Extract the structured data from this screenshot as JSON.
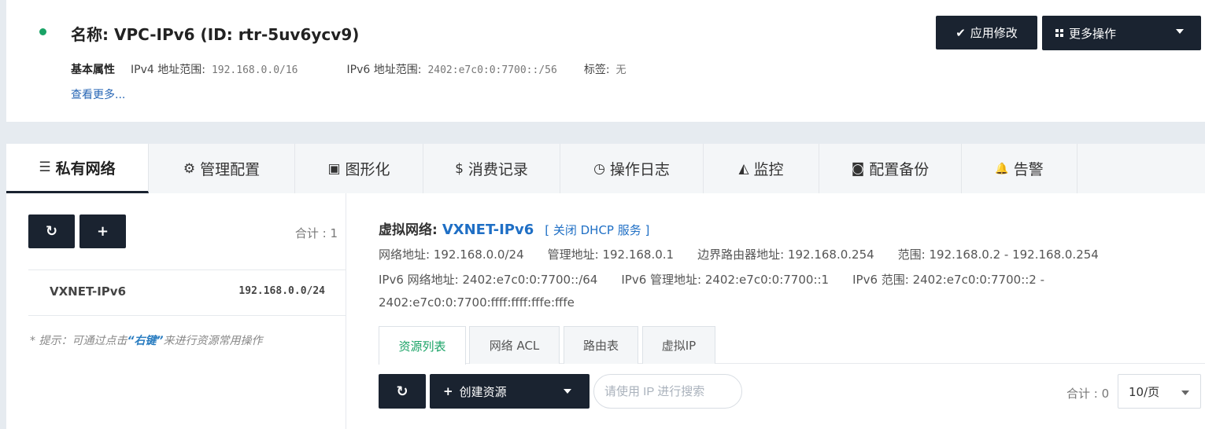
{
  "header": {
    "title": "名称: VPC-IPv6 (ID: rtr-5uv6ycv9)",
    "status_color": "#1aa366",
    "basic_props_label": "基本属性",
    "ipv4_label": "IPv4 地址范围:",
    "ipv4_value": "192.168.0.0/16",
    "ipv6_label": "IPv6 地址范围:",
    "ipv6_value": "2402:e7c0:0:7700::/56",
    "tags_label": "标签:",
    "tags_value": "无",
    "see_more": "查看更多...",
    "apply_button": "应用修改",
    "more_actions_button": "更多操作"
  },
  "tabs": [
    {
      "label": "私有网络",
      "icon": "list-icon",
      "glyph": "☰"
    },
    {
      "label": "管理配置",
      "icon": "gears-icon",
      "glyph": "⚙"
    },
    {
      "label": "图形化",
      "icon": "image-icon",
      "glyph": "▣"
    },
    {
      "label": "消费记录",
      "icon": "dollar-icon",
      "glyph": "$"
    },
    {
      "label": "操作日志",
      "icon": "clock-icon",
      "glyph": "◷"
    },
    {
      "label": "监控",
      "icon": "area-chart-icon",
      "glyph": "◭"
    },
    {
      "label": "配置备份",
      "icon": "camera-icon",
      "glyph": "◙"
    },
    {
      "label": "告警",
      "icon": "bell-icon",
      "glyph": "🔔"
    }
  ],
  "left": {
    "refresh_glyph": "↻",
    "add_glyph": "+",
    "total": "合计 : 1",
    "vxnet_name": "VXNET-IPv6",
    "vxnet_cidr": "192.168.0.0/24",
    "hint_prefix": "* 提示：可通过点击",
    "hint_highlight": "“右键”",
    "hint_suffix": "来进行资源常用操作"
  },
  "vxnet": {
    "label": "虚拟网络:",
    "name": "VXNET-IPv6",
    "dhcp_link": "[ 关闭 DHCP 服务 ]",
    "net_addr": "网络地址: 192.168.0.0/24",
    "mgmt_addr": "管理地址: 192.168.0.1",
    "border_router": "边界路由器地址: 192.168.0.254",
    "range": "范围: 192.168.0.2 - 192.168.0.254",
    "ipv6_net": "IPv6 网络地址: 2402:e7c0:0:7700::/64",
    "ipv6_mgmt": "IPv6 管理地址: 2402:e7c0:0:7700::1",
    "ipv6_range": "IPv6 范围: 2402:e7c0:0:7700::2 -",
    "ipv6_range_cont": "2402:e7c0:0:7700:ffff:ffff:fffe:fffe"
  },
  "subtabs": [
    "资源列表",
    "网络 ACL",
    "路由表",
    "虚拟IP"
  ],
  "toolbar": {
    "refresh_glyph": "↻",
    "create_label": "创建资源",
    "search_placeholder": "请使用 IP 进行搜索",
    "total": "合计 : 0",
    "page_size": "10/页"
  }
}
